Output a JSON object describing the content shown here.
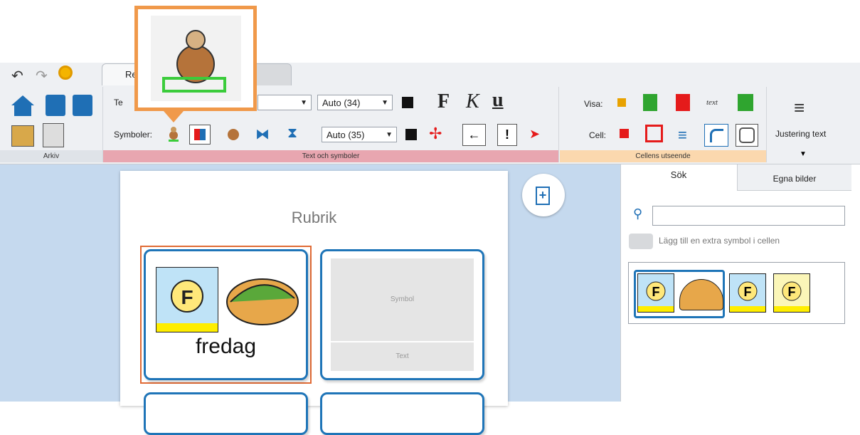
{
  "tabs": [
    {
      "label": "Re"
    },
    {
      "label": ""
    }
  ],
  "file_group": {
    "footer": "Arkiv"
  },
  "text_group": {
    "text_label": "Te",
    "symbols_label": "Symboler:",
    "text_size": "Auto (34)",
    "symbol_size": "Auto (35)",
    "bold_label": "F",
    "italic_label": "K",
    "underline_label": "u",
    "footer": "Text och symboler"
  },
  "cell_group": {
    "show_label": "Visa:",
    "cell_label": "Cell:",
    "footer": "Cellens utseende",
    "text_icon": "text",
    "accent_color": "#e51b1b"
  },
  "justify_group": {
    "label": "Justering text"
  },
  "document": {
    "title": "Rubrik",
    "cell1_text": "fredag",
    "cell2_symbol_placeholder": "Symbol",
    "cell2_text_placeholder": "Text"
  },
  "panel": {
    "tab_search": "Sök",
    "tab_own": "Egna bilder",
    "search_value": "",
    "add_symbol_label": "Lägg till en extra symbol i cellen",
    "letter": "F"
  },
  "callout": {
    "icon": "cat-symbol-icon"
  }
}
